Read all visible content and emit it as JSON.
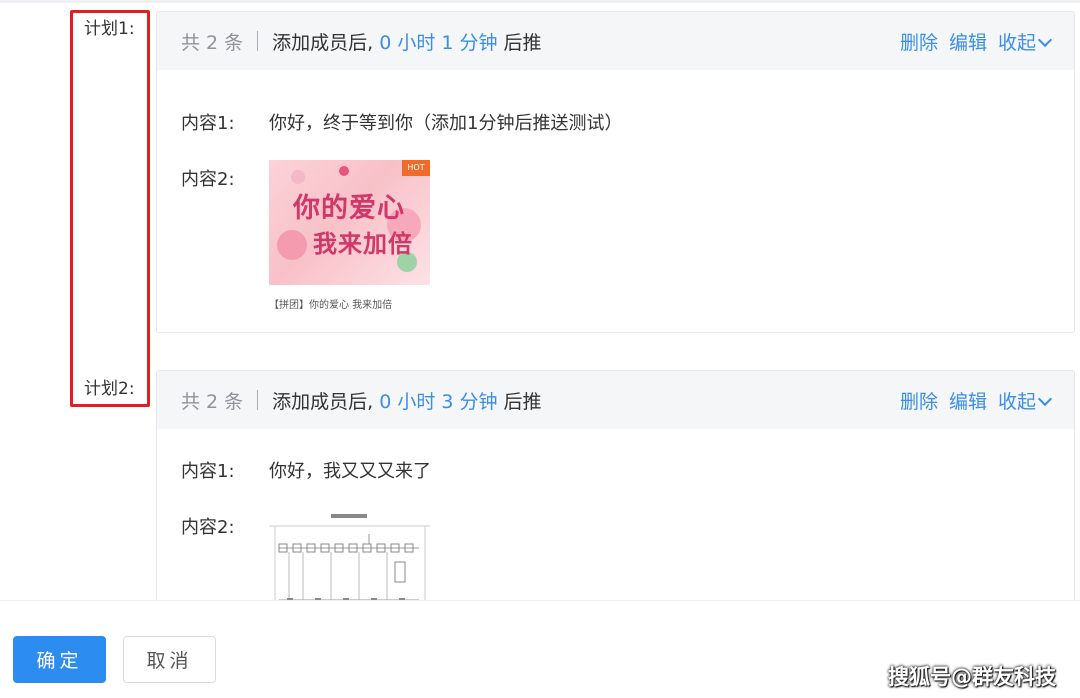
{
  "plans": [
    {
      "label": "计划1:",
      "count_text": "共 2 条",
      "delay_prefix": "添加成员后,",
      "delay_value": "0 小时 1 分钟",
      "delay_suffix": "后推",
      "actions": {
        "delete": "删除",
        "edit": "编辑",
        "collapse": "收起"
      },
      "contents": [
        {
          "key": "内容1:",
          "text": "你好，终于等到你（添加1分钟后推送测试）"
        },
        {
          "key": "内容2:",
          "image_title_line1": "你的爱心",
          "image_title_line2": "我来加倍",
          "image_badge": "HOT",
          "caption": "【拼团】你的爱心 我来加倍"
        }
      ]
    },
    {
      "label": "计划2:",
      "count_text": "共 2 条",
      "delay_prefix": "添加成员后,",
      "delay_value": "0 小时 3 分钟",
      "delay_suffix": "后推",
      "actions": {
        "delete": "删除",
        "edit": "编辑",
        "collapse": "收起"
      },
      "contents": [
        {
          "key": "内容1:",
          "text": "你好，我又又又来了"
        },
        {
          "key": "内容2:"
        }
      ]
    }
  ],
  "footer": {
    "confirm": "确定",
    "cancel": "取消"
  },
  "watermark": "搜狐号@群友科技",
  "colors": {
    "accent": "#3a8ee6",
    "highlight_box": "#e02020",
    "primary_button": "#2d8cf0"
  }
}
